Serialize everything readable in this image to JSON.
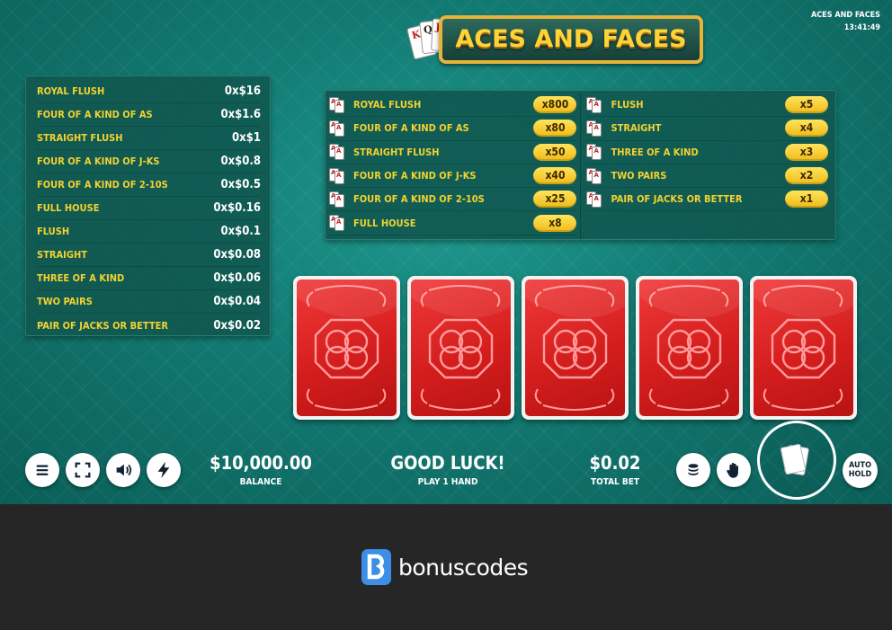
{
  "header": {
    "game_title": "ACES AND FACES",
    "clock": "13:41:49"
  },
  "logo": {
    "text": "ACES AND FACES",
    "card_letters": [
      "K",
      "Q",
      "J",
      "A"
    ]
  },
  "paytable_left": [
    {
      "hand": "ROYAL FLUSH",
      "payout": "0x$16"
    },
    {
      "hand": "FOUR OF A KIND OF AS",
      "payout": "0x$1.6"
    },
    {
      "hand": "STRAIGHT FLUSH",
      "payout": "0x$1"
    },
    {
      "hand": "FOUR OF A KIND OF J-KS",
      "payout": "0x$0.8"
    },
    {
      "hand": "FOUR OF A KIND OF 2-10S",
      "payout": "0x$0.5"
    },
    {
      "hand": "FULL HOUSE",
      "payout": "0x$0.16"
    },
    {
      "hand": "FLUSH",
      "payout": "0x$0.1"
    },
    {
      "hand": "STRAIGHT",
      "payout": "0x$0.08"
    },
    {
      "hand": "THREE OF A KIND",
      "payout": "0x$0.06"
    },
    {
      "hand": "TWO PAIRS",
      "payout": "0x$0.04"
    },
    {
      "hand": "PAIR OF JACKS OR BETTER",
      "payout": "0x$0.02"
    }
  ],
  "paytable_right": {
    "col1": [
      {
        "hand": "ROYAL FLUSH",
        "mult": "x800"
      },
      {
        "hand": "FOUR OF A KIND OF AS",
        "mult": "x80"
      },
      {
        "hand": "STRAIGHT FLUSH",
        "mult": "x50"
      },
      {
        "hand": "FOUR OF A KIND OF J-KS",
        "mult": "x40"
      },
      {
        "hand": "FOUR OF A KIND OF 2-10S",
        "mult": "x25"
      },
      {
        "hand": "FULL HOUSE",
        "mult": "x8"
      }
    ],
    "col2": [
      {
        "hand": "FLUSH",
        "mult": "x5"
      },
      {
        "hand": "STRAIGHT",
        "mult": "x4"
      },
      {
        "hand": "THREE OF A KIND",
        "mult": "x3"
      },
      {
        "hand": "TWO PAIRS",
        "mult": "x2"
      },
      {
        "hand": "PAIR OF JACKS OR BETTER",
        "mult": "x1"
      }
    ],
    "icon_letter": "A"
  },
  "cards": [
    {
      "state": "face-down"
    },
    {
      "state": "face-down"
    },
    {
      "state": "face-down"
    },
    {
      "state": "face-down"
    },
    {
      "state": "face-down"
    }
  ],
  "controls": {
    "icons": [
      "menu-icon",
      "fullscreen-icon",
      "sound-icon",
      "turbo-icon",
      "coins-icon",
      "hold-hand-icon",
      "deal-cards-icon"
    ]
  },
  "balance": {
    "value": "$10,000.00",
    "label": "BALANCE"
  },
  "message": {
    "value": "GOOD LUCK!",
    "label": "PLAY 1 HAND"
  },
  "total_bet": {
    "value": "$0.02",
    "label": "TOTAL BET"
  },
  "autohold": {
    "line1": "AUTO",
    "line2": "HOLD"
  },
  "footer": {
    "brand": "bonuscodes"
  },
  "colors": {
    "felt": "#127a72",
    "gold_text": "#f4d22f",
    "badge": "#f0bb18",
    "card_red": "#d51e1e",
    "footer_bg": "#262626",
    "brand_blue": "#3c8fe6"
  }
}
